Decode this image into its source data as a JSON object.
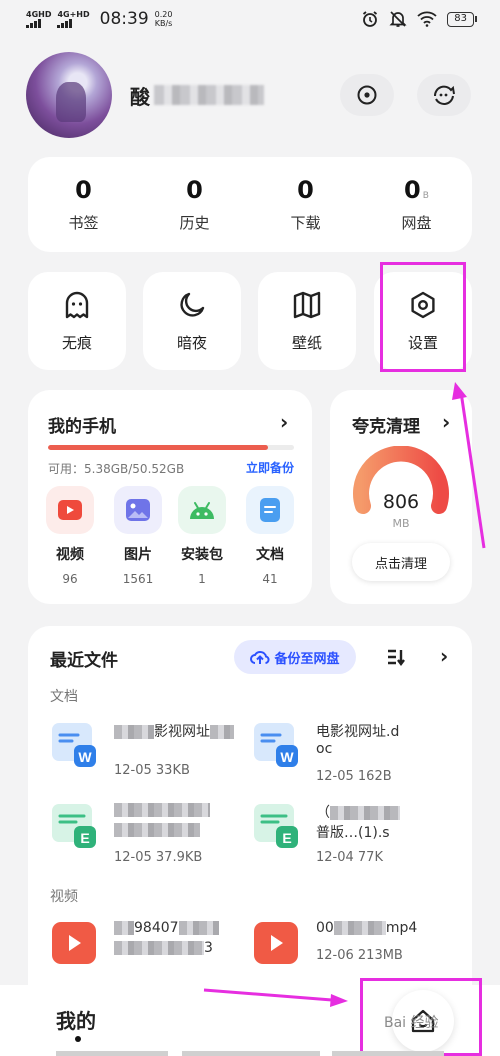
{
  "status_bar": {
    "sim1": "4GHD",
    "sim2": "4G+HD",
    "time": "08:39",
    "speed_value": "0.20",
    "speed_unit": "KB/s",
    "battery": "83",
    "icons": [
      "alarm-icon",
      "mute-icon",
      "wifi-icon",
      "battery-icon"
    ]
  },
  "profile": {
    "nickname_initial": "酸",
    "header_buttons": [
      "eye-icon",
      "skin-icon"
    ]
  },
  "stats": [
    {
      "value": "0",
      "unit": "",
      "label": "书签"
    },
    {
      "value": "0",
      "unit": "",
      "label": "历史"
    },
    {
      "value": "0",
      "unit": "",
      "label": "下载"
    },
    {
      "value": "0",
      "unit": "B",
      "label": "网盘"
    }
  ],
  "tools": [
    {
      "label": "无痕",
      "icon": "ghost-icon"
    },
    {
      "label": "暗夜",
      "icon": "moon-icon"
    },
    {
      "label": "壁纸",
      "icon": "book-icon"
    },
    {
      "label": "设置",
      "icon": "settings-hexagon-icon"
    }
  ],
  "my_phone": {
    "title": "我的手机",
    "storage_text": "可用：5.38GB/50.52GB",
    "storage_used_fraction": 0.894,
    "backup_label": "立即备份",
    "categories": [
      {
        "label": "视频",
        "count": "96",
        "icon": "video-icon",
        "color": "#ef4a3c",
        "bg": "#fdecea"
      },
      {
        "label": "图片",
        "count": "1561",
        "icon": "image-icon",
        "color": "#6f74e8",
        "bg": "#eeeefc"
      },
      {
        "label": "安装包",
        "count": "1",
        "icon": "android-icon",
        "color": "#3dbb62",
        "bg": "#e9f7ee"
      },
      {
        "label": "文档",
        "count": "41",
        "icon": "document-icon",
        "color": "#4a9ef0",
        "bg": "#e9f3fd"
      }
    ]
  },
  "cleaner": {
    "title": "夸克清理",
    "value": "806",
    "unit": "MB",
    "button_label": "点击清理"
  },
  "recent": {
    "title": "最近文件",
    "cloud_button": "备份至网盘",
    "sections": {
      "docs": "文档",
      "videos": "视频"
    },
    "files": [
      {
        "line1": "影视网址",
        "line2": "",
        "meta": "12-05 33KB",
        "type": "word"
      },
      {
        "line1": "电影视网址.d",
        "line2": "oc",
        "meta": "12-05 162B",
        "type": "word"
      },
      {
        "line1": "",
        "line2": "",
        "meta": "12-05 37.9KB",
        "type": "excel"
      },
      {
        "line1": "（",
        "line2": "普版…(1).s",
        "meta": "12-04 77K",
        "type": "excel"
      },
      {
        "line1": "98407",
        "line2": "3",
        "meta": "",
        "type": "video"
      },
      {
        "line1": "00",
        "line2": "mp4",
        "meta": "12-06 213MB",
        "type": "video"
      }
    ]
  },
  "bottom": {
    "title": "我的",
    "watermark": "Bai 经验"
  }
}
